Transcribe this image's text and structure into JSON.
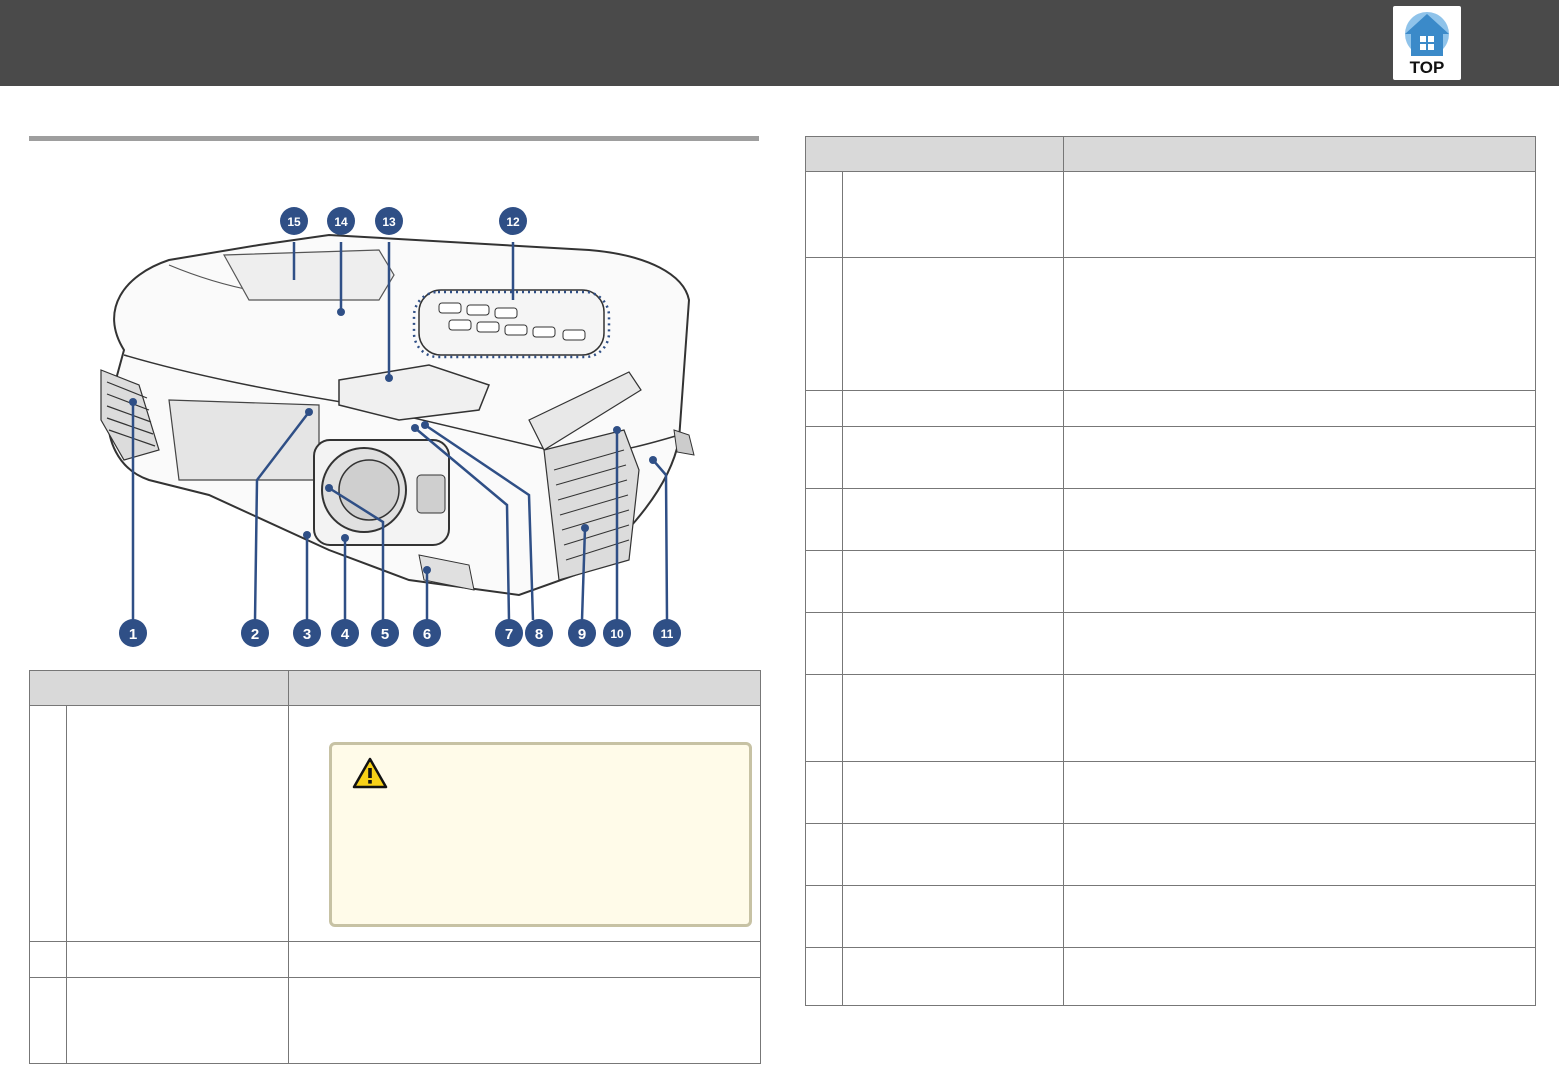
{
  "header": {
    "top_button_label": "TOP",
    "top_icon": "top-home-icon"
  },
  "figure": {
    "callout_numbers": [
      "1",
      "2",
      "3",
      "4",
      "5",
      "6",
      "7",
      "8",
      "9",
      "10",
      "11",
      "12",
      "13",
      "14",
      "15"
    ],
    "line_color": "#2f4f86"
  },
  "left_table": {
    "header_name": "",
    "header_function": "",
    "warning_icon": "warning-triangle-icon"
  },
  "right_table": {
    "header_name": "",
    "header_function": ""
  },
  "colors": {
    "header_bar": "#4a4a4a",
    "table_header": "#d9d9d9",
    "callout_background": "#fffbe9",
    "callout_border": "#c7c2a4",
    "brand_blue": "#3b8ac9"
  }
}
